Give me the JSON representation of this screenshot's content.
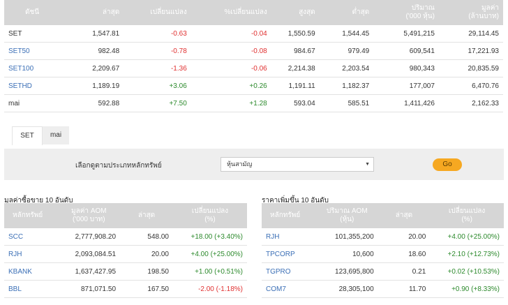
{
  "index_table": {
    "headers": [
      "ดัชนี",
      "ล่าสุด",
      "เปลี่ยนแปลง",
      "%เปลี่ยนแปลง",
      "สูงสุด",
      "ต่ำสุด",
      "ปริมาณ\n('000 หุ้น)",
      "มูลค่า\n(ล้านบาท)"
    ],
    "rows": [
      {
        "name": "SET",
        "last": "1,547.81",
        "change": "-0.63",
        "pct": "-0.04",
        "high": "1,550.59",
        "low": "1,544.45",
        "volume": "5,491,215",
        "value": "29,114.45",
        "name_color": "plain",
        "dir": "down"
      },
      {
        "name": "SET50",
        "last": "982.48",
        "change": "-0.78",
        "pct": "-0.08",
        "high": "984.67",
        "low": "979.49",
        "volume": "609,541",
        "value": "17,221.93",
        "name_color": "blue",
        "dir": "down"
      },
      {
        "name": "SET100",
        "last": "2,209.67",
        "change": "-1.36",
        "pct": "-0.06",
        "high": "2,214.38",
        "low": "2,203.54",
        "volume": "980,343",
        "value": "20,835.59",
        "name_color": "blue",
        "dir": "down"
      },
      {
        "name": "SETHD",
        "last": "1,189.19",
        "change": "+3.06",
        "pct": "+0.26",
        "high": "1,191.11",
        "low": "1,182.37",
        "volume": "177,007",
        "value": "6,470.76",
        "name_color": "blue",
        "dir": "up"
      },
      {
        "name": "mai",
        "last": "592.88",
        "change": "+7.50",
        "pct": "+1.28",
        "high": "593.04",
        "low": "585.51",
        "volume": "1,411,426",
        "value": "2,162.33",
        "name_color": "plain",
        "dir": "up"
      }
    ]
  },
  "tabs": [
    {
      "label": "SET",
      "active": true
    },
    {
      "label": "mai",
      "active": false
    }
  ],
  "filter": {
    "label": "เลือกดูตามประเภทหลักทรัพย์",
    "selected": "หุ้นสามัญ",
    "go_label": "Go"
  },
  "top_value": {
    "title": "มูลค่าซื้อขาย 10 อันดับ",
    "headers": [
      "หลักทรัพย์",
      "มูลค่า AOM\n('000 บาท)",
      "ล่าสุด",
      "เปลี่ยนแปลง\n(%)"
    ],
    "rows": [
      {
        "name": "SCC",
        "aom": "2,777,908.20",
        "last": "548.00",
        "change": "+18.00 (+3.40%)",
        "dir": "up"
      },
      {
        "name": "RJH",
        "aom": "2,093,084.51",
        "last": "20.00",
        "change": "+4.00 (+25.00%)",
        "dir": "up"
      },
      {
        "name": "KBANK",
        "aom": "1,637,427.95",
        "last": "198.50",
        "change": "+1.00 (+0.51%)",
        "dir": "up"
      },
      {
        "name": "BBL",
        "aom": "871,071.50",
        "last": "167.50",
        "change": "-2.00 (-1.18%)",
        "dir": "down"
      }
    ]
  },
  "top_gainers": {
    "title": "ราคาเพิ่มขึ้น 10 อันดับ",
    "headers": [
      "หลักทรัพย์",
      "ปริมาณ AOM\n(หุ้น)",
      "ล่าสุด",
      "เปลี่ยนแปลง\n(%)"
    ],
    "rows": [
      {
        "name": "RJH",
        "aom": "101,355,200",
        "last": "20.00",
        "change": "+4.00 (+25.00%)",
        "dir": "up"
      },
      {
        "name": "TPCORP",
        "aom": "10,600",
        "last": "18.60",
        "change": "+2.10 (+12.73%)",
        "dir": "up"
      },
      {
        "name": "TGPRO",
        "aom": "123,695,800",
        "last": "0.21",
        "change": "+0.02 (+10.53%)",
        "dir": "up"
      },
      {
        "name": "COM7",
        "aom": "28,305,100",
        "last": "11.70",
        "change": "+0.90 (+8.33%)",
        "dir": "up"
      }
    ]
  },
  "colors": {
    "up": "#2d8a2d",
    "down": "#e03030",
    "link": "#3b6fb6",
    "header_bg": "#d6d6d6",
    "go_button": "#f6a821"
  }
}
